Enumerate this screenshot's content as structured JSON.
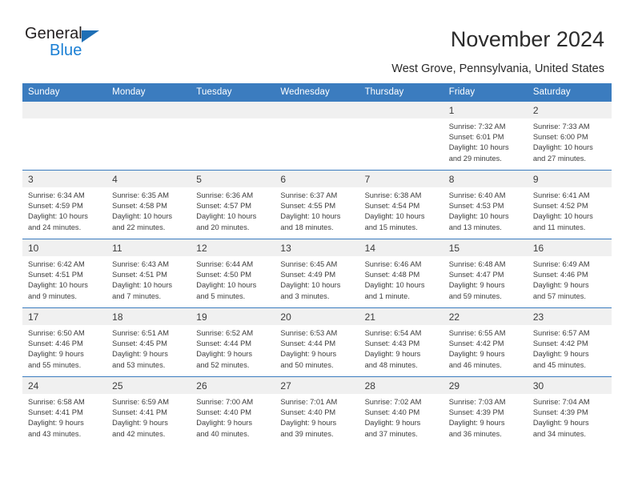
{
  "brand": {
    "name_part1": "General",
    "name_part2": "Blue",
    "triangle_color": "#1f6fb5",
    "blue_text_color": "#1a7fd4"
  },
  "header": {
    "title": "November 2024",
    "location": "West Grove, Pennsylvania, United States"
  },
  "theme": {
    "header_blue": "#3b7cbf",
    "daynum_band": "#f0f0f0",
    "text": "#3c3c3c"
  },
  "calendar": {
    "weekday_headers": [
      "Sunday",
      "Monday",
      "Tuesday",
      "Wednesday",
      "Thursday",
      "Friday",
      "Saturday"
    ],
    "labels": {
      "sunrise": "Sunrise:",
      "sunset": "Sunset:",
      "daylight": "Daylight:"
    },
    "weeks": [
      [
        {
          "day": "",
          "blank": true
        },
        {
          "day": "",
          "blank": true
        },
        {
          "day": "",
          "blank": true
        },
        {
          "day": "",
          "blank": true
        },
        {
          "day": "",
          "blank": true
        },
        {
          "day": "1",
          "sunrise": "Sunrise: 7:32 AM",
          "sunset": "Sunset: 6:01 PM",
          "daylight_line1": "Daylight: 10 hours",
          "daylight_line2": "and 29 minutes."
        },
        {
          "day": "2",
          "sunrise": "Sunrise: 7:33 AM",
          "sunset": "Sunset: 6:00 PM",
          "daylight_line1": "Daylight: 10 hours",
          "daylight_line2": "and 27 minutes."
        }
      ],
      [
        {
          "day": "3",
          "sunrise": "Sunrise: 6:34 AM",
          "sunset": "Sunset: 4:59 PM",
          "daylight_line1": "Daylight: 10 hours",
          "daylight_line2": "and 24 minutes."
        },
        {
          "day": "4",
          "sunrise": "Sunrise: 6:35 AM",
          "sunset": "Sunset: 4:58 PM",
          "daylight_line1": "Daylight: 10 hours",
          "daylight_line2": "and 22 minutes."
        },
        {
          "day": "5",
          "sunrise": "Sunrise: 6:36 AM",
          "sunset": "Sunset: 4:57 PM",
          "daylight_line1": "Daylight: 10 hours",
          "daylight_line2": "and 20 minutes."
        },
        {
          "day": "6",
          "sunrise": "Sunrise: 6:37 AM",
          "sunset": "Sunset: 4:55 PM",
          "daylight_line1": "Daylight: 10 hours",
          "daylight_line2": "and 18 minutes."
        },
        {
          "day": "7",
          "sunrise": "Sunrise: 6:38 AM",
          "sunset": "Sunset: 4:54 PM",
          "daylight_line1": "Daylight: 10 hours",
          "daylight_line2": "and 15 minutes."
        },
        {
          "day": "8",
          "sunrise": "Sunrise: 6:40 AM",
          "sunset": "Sunset: 4:53 PM",
          "daylight_line1": "Daylight: 10 hours",
          "daylight_line2": "and 13 minutes."
        },
        {
          "day": "9",
          "sunrise": "Sunrise: 6:41 AM",
          "sunset": "Sunset: 4:52 PM",
          "daylight_line1": "Daylight: 10 hours",
          "daylight_line2": "and 11 minutes."
        }
      ],
      [
        {
          "day": "10",
          "sunrise": "Sunrise: 6:42 AM",
          "sunset": "Sunset: 4:51 PM",
          "daylight_line1": "Daylight: 10 hours",
          "daylight_line2": "and 9 minutes."
        },
        {
          "day": "11",
          "sunrise": "Sunrise: 6:43 AM",
          "sunset": "Sunset: 4:51 PM",
          "daylight_line1": "Daylight: 10 hours",
          "daylight_line2": "and 7 minutes."
        },
        {
          "day": "12",
          "sunrise": "Sunrise: 6:44 AM",
          "sunset": "Sunset: 4:50 PM",
          "daylight_line1": "Daylight: 10 hours",
          "daylight_line2": "and 5 minutes."
        },
        {
          "day": "13",
          "sunrise": "Sunrise: 6:45 AM",
          "sunset": "Sunset: 4:49 PM",
          "daylight_line1": "Daylight: 10 hours",
          "daylight_line2": "and 3 minutes."
        },
        {
          "day": "14",
          "sunrise": "Sunrise: 6:46 AM",
          "sunset": "Sunset: 4:48 PM",
          "daylight_line1": "Daylight: 10 hours",
          "daylight_line2": "and 1 minute."
        },
        {
          "day": "15",
          "sunrise": "Sunrise: 6:48 AM",
          "sunset": "Sunset: 4:47 PM",
          "daylight_line1": "Daylight: 9 hours",
          "daylight_line2": "and 59 minutes."
        },
        {
          "day": "16",
          "sunrise": "Sunrise: 6:49 AM",
          "sunset": "Sunset: 4:46 PM",
          "daylight_line1": "Daylight: 9 hours",
          "daylight_line2": "and 57 minutes."
        }
      ],
      [
        {
          "day": "17",
          "sunrise": "Sunrise: 6:50 AM",
          "sunset": "Sunset: 4:46 PM",
          "daylight_line1": "Daylight: 9 hours",
          "daylight_line2": "and 55 minutes."
        },
        {
          "day": "18",
          "sunrise": "Sunrise: 6:51 AM",
          "sunset": "Sunset: 4:45 PM",
          "daylight_line1": "Daylight: 9 hours",
          "daylight_line2": "and 53 minutes."
        },
        {
          "day": "19",
          "sunrise": "Sunrise: 6:52 AM",
          "sunset": "Sunset: 4:44 PM",
          "daylight_line1": "Daylight: 9 hours",
          "daylight_line2": "and 52 minutes."
        },
        {
          "day": "20",
          "sunrise": "Sunrise: 6:53 AM",
          "sunset": "Sunset: 4:44 PM",
          "daylight_line1": "Daylight: 9 hours",
          "daylight_line2": "and 50 minutes."
        },
        {
          "day": "21",
          "sunrise": "Sunrise: 6:54 AM",
          "sunset": "Sunset: 4:43 PM",
          "daylight_line1": "Daylight: 9 hours",
          "daylight_line2": "and 48 minutes."
        },
        {
          "day": "22",
          "sunrise": "Sunrise: 6:55 AM",
          "sunset": "Sunset: 4:42 PM",
          "daylight_line1": "Daylight: 9 hours",
          "daylight_line2": "and 46 minutes."
        },
        {
          "day": "23",
          "sunrise": "Sunrise: 6:57 AM",
          "sunset": "Sunset: 4:42 PM",
          "daylight_line1": "Daylight: 9 hours",
          "daylight_line2": "and 45 minutes."
        }
      ],
      [
        {
          "day": "24",
          "sunrise": "Sunrise: 6:58 AM",
          "sunset": "Sunset: 4:41 PM",
          "daylight_line1": "Daylight: 9 hours",
          "daylight_line2": "and 43 minutes."
        },
        {
          "day": "25",
          "sunrise": "Sunrise: 6:59 AM",
          "sunset": "Sunset: 4:41 PM",
          "daylight_line1": "Daylight: 9 hours",
          "daylight_line2": "and 42 minutes."
        },
        {
          "day": "26",
          "sunrise": "Sunrise: 7:00 AM",
          "sunset": "Sunset: 4:40 PM",
          "daylight_line1": "Daylight: 9 hours",
          "daylight_line2": "and 40 minutes."
        },
        {
          "day": "27",
          "sunrise": "Sunrise: 7:01 AM",
          "sunset": "Sunset: 4:40 PM",
          "daylight_line1": "Daylight: 9 hours",
          "daylight_line2": "and 39 minutes."
        },
        {
          "day": "28",
          "sunrise": "Sunrise: 7:02 AM",
          "sunset": "Sunset: 4:40 PM",
          "daylight_line1": "Daylight: 9 hours",
          "daylight_line2": "and 37 minutes."
        },
        {
          "day": "29",
          "sunrise": "Sunrise: 7:03 AM",
          "sunset": "Sunset: 4:39 PM",
          "daylight_line1": "Daylight: 9 hours",
          "daylight_line2": "and 36 minutes."
        },
        {
          "day": "30",
          "sunrise": "Sunrise: 7:04 AM",
          "sunset": "Sunset: 4:39 PM",
          "daylight_line1": "Daylight: 9 hours",
          "daylight_line2": "and 34 minutes."
        }
      ]
    ]
  }
}
